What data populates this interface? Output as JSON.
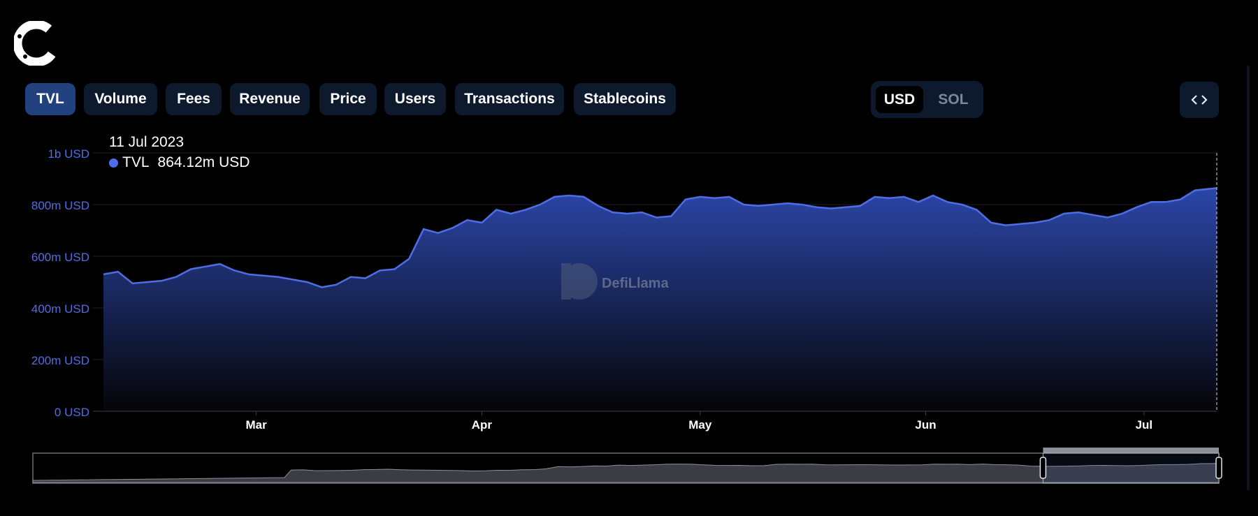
{
  "tabs": [
    {
      "label": "TVL",
      "active": true
    },
    {
      "label": "Volume",
      "active": false
    },
    {
      "label": "Fees",
      "active": false
    },
    {
      "label": "Revenue",
      "active": false
    },
    {
      "label": "Price",
      "active": false
    },
    {
      "label": "Users",
      "active": false
    },
    {
      "label": "Transactions",
      "active": false
    },
    {
      "label": "Stablecoins",
      "active": false
    }
  ],
  "currency": {
    "selected": "USD",
    "other": "SOL"
  },
  "embed_icon": "code-brackets-icon",
  "logo_icon": "c-logo-icon",
  "watermark": "DefiLlama",
  "tooltip": {
    "date": "11 Jul 2023",
    "series": "TVL",
    "value": "864.12m USD"
  },
  "colors": {
    "line": "#4f6ee6",
    "area_top": "#2b46a8",
    "tab_active": "#21427e",
    "tab_bg": "#0d1a2e",
    "axis_text": "#4f6ee6"
  },
  "chart_data": {
    "type": "area",
    "x_ticks": [
      "Mar",
      "Apr",
      "May",
      "Jun",
      "Jul"
    ],
    "y_ticks": [
      "0 USD",
      "200m USD",
      "400m USD",
      "600m USD",
      "800m USD",
      "1b USD"
    ],
    "ylim": [
      0,
      1000
    ],
    "unit": "m USD",
    "grid": true,
    "series": [
      {
        "name": "TVL",
        "x": [
          "2023-02-08",
          "2023-02-10",
          "2023-02-12",
          "2023-02-14",
          "2023-02-16",
          "2023-02-18",
          "2023-02-20",
          "2023-02-22",
          "2023-02-24",
          "2023-02-26",
          "2023-02-28",
          "2023-03-02",
          "2023-03-04",
          "2023-03-06",
          "2023-03-08",
          "2023-03-10",
          "2023-03-12",
          "2023-03-14",
          "2023-03-16",
          "2023-03-18",
          "2023-03-20",
          "2023-03-22",
          "2023-03-24",
          "2023-03-26",
          "2023-03-28",
          "2023-03-30",
          "2023-04-01",
          "2023-04-03",
          "2023-04-05",
          "2023-04-07",
          "2023-04-09",
          "2023-04-11",
          "2023-04-13",
          "2023-04-15",
          "2023-04-17",
          "2023-04-19",
          "2023-04-21",
          "2023-04-23",
          "2023-04-25",
          "2023-04-27",
          "2023-04-29",
          "2023-05-01",
          "2023-05-03",
          "2023-05-05",
          "2023-05-07",
          "2023-05-09",
          "2023-05-11",
          "2023-05-13",
          "2023-05-15",
          "2023-05-17",
          "2023-05-19",
          "2023-05-21",
          "2023-05-23",
          "2023-05-25",
          "2023-05-27",
          "2023-05-29",
          "2023-05-31",
          "2023-06-02",
          "2023-06-04",
          "2023-06-06",
          "2023-06-08",
          "2023-06-10",
          "2023-06-12",
          "2023-06-14",
          "2023-06-16",
          "2023-06-18",
          "2023-06-20",
          "2023-06-22",
          "2023-06-24",
          "2023-06-26",
          "2023-06-28",
          "2023-06-30",
          "2023-07-02",
          "2023-07-04",
          "2023-07-06",
          "2023-07-08",
          "2023-07-11"
        ],
        "values": [
          530,
          540,
          495,
          500,
          505,
          520,
          550,
          560,
          570,
          545,
          530,
          525,
          520,
          510,
          500,
          480,
          490,
          520,
          515,
          545,
          550,
          590,
          705,
          690,
          710,
          740,
          730,
          780,
          765,
          780,
          800,
          830,
          835,
          830,
          795,
          770,
          765,
          770,
          750,
          755,
          820,
          830,
          825,
          830,
          800,
          795,
          800,
          805,
          800,
          790,
          785,
          790,
          795,
          830,
          825,
          830,
          810,
          835,
          810,
          800,
          780,
          730,
          720,
          725,
          730,
          740,
          765,
          770,
          760,
          750,
          765,
          790,
          810,
          810,
          820,
          855,
          864
        ]
      }
    ]
  },
  "navigator": {
    "range_start": "2023-06-12",
    "range_end": "2023-07-11"
  }
}
